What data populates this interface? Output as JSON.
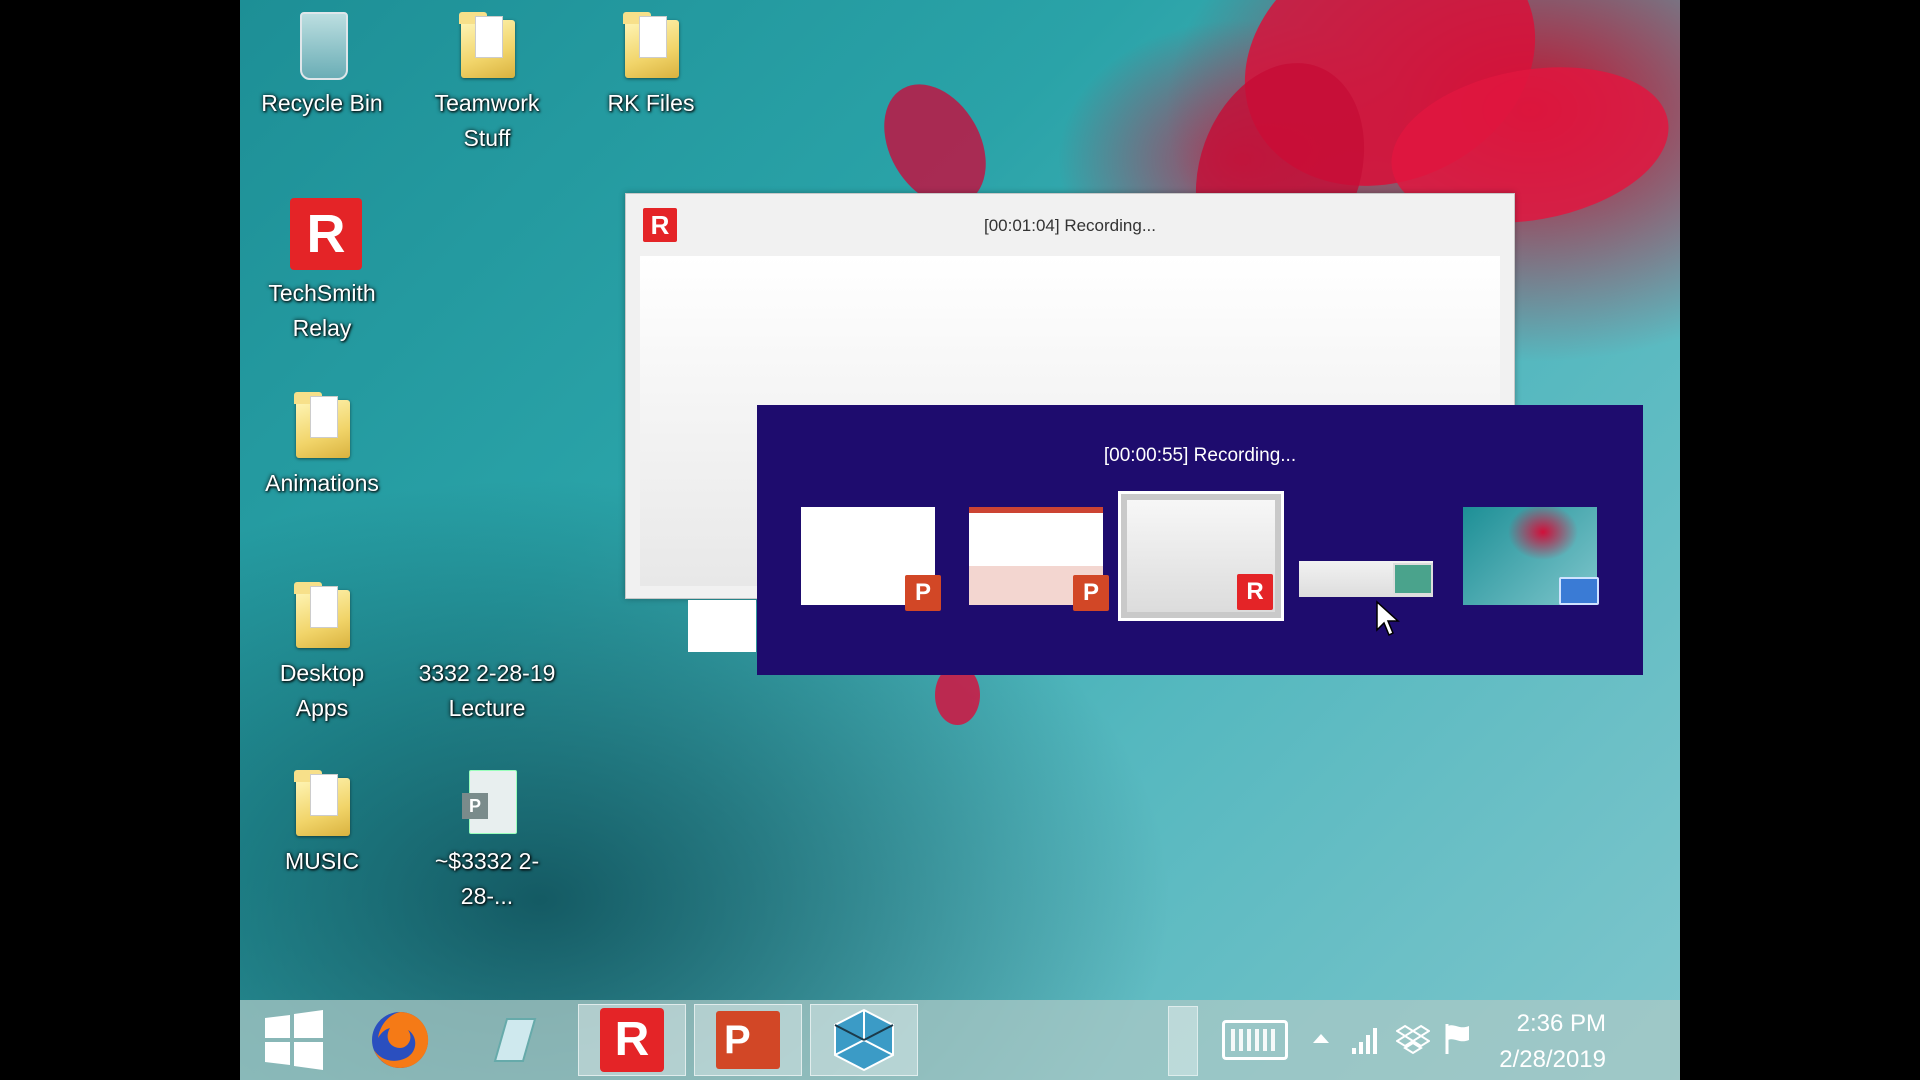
{
  "desktop": {
    "icons": [
      {
        "label": "Recycle Bin"
      },
      {
        "label": "Teamwork Stuff"
      },
      {
        "label": "RK Files"
      },
      {
        "label": "TechSmith Relay"
      },
      {
        "label": "Animations"
      },
      {
        "label": "Desktop Apps"
      },
      {
        "label": "3332 2-28-19 Lecture"
      },
      {
        "label": "MUSIC"
      },
      {
        "label": "~$3332 2-28-..."
      }
    ]
  },
  "recording_window": {
    "title": "[00:01:04] Recording...",
    "logo_letter": "R"
  },
  "task_switcher": {
    "title": "[00:00:55] Recording...",
    "thumbnails": [
      {
        "name": "powerpoint-blank",
        "badge": "P"
      },
      {
        "name": "powerpoint-slides",
        "badge": "P"
      },
      {
        "name": "techsmith-relay-recording",
        "badge": "R",
        "selected": true
      },
      {
        "name": "dialog-window",
        "badge": ""
      },
      {
        "name": "desktop",
        "badge": ""
      }
    ]
  },
  "taskbar": {
    "apps": [
      "start-icon",
      "firefox-icon",
      "notes-icon",
      "techsmith-relay-icon",
      "powerpoint-icon",
      "sketchup-icon"
    ],
    "powerpoint_badge": "P",
    "relay_badge": "R",
    "clock": {
      "time": "2:36 PM",
      "date": "2/28/2019"
    }
  },
  "colors": {
    "switcher_bg": "#1e0c6e",
    "relay_red": "#e42427",
    "ppt_orange": "#d24726"
  }
}
